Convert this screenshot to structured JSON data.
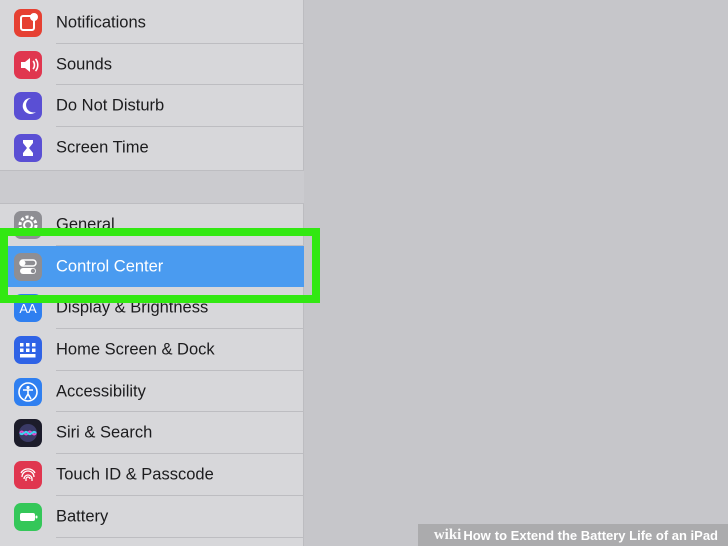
{
  "settings_group_top": [
    {
      "name": "notifications",
      "label": "Notifications",
      "icon": "notifications-icon",
      "color": "#e64032"
    },
    {
      "name": "sounds",
      "label": "Sounds",
      "icon": "speaker-icon",
      "color": "#e0364f"
    },
    {
      "name": "do-not-disturb",
      "label": "Do Not Disturb",
      "icon": "moon-icon",
      "color": "#5a4fd4"
    },
    {
      "name": "screen-time",
      "label": "Screen Time",
      "icon": "hourglass-icon",
      "color": "#5a4fd4"
    }
  ],
  "settings_group_main": [
    {
      "name": "general",
      "label": "General",
      "icon": "gear-icon",
      "color": "#8e8e93"
    },
    {
      "name": "control-center",
      "label": "Control Center",
      "icon": "toggles-icon",
      "color": "#8e8e93",
      "selected": true
    },
    {
      "name": "display-brightness",
      "label": "Display & Brightness",
      "icon": "aa-icon",
      "color": "#2f7ff0"
    },
    {
      "name": "home-screen-dock",
      "label": "Home Screen & Dock",
      "icon": "grid-icon",
      "color": "#2f63e6"
    },
    {
      "name": "accessibility",
      "label": "Accessibility",
      "icon": "accessibility-icon",
      "color": "#2f7ff0"
    },
    {
      "name": "siri-search",
      "label": "Siri & Search",
      "icon": "siri-icon",
      "color": "#1c1c2a"
    },
    {
      "name": "touch-id-passcode",
      "label": "Touch ID & Passcode",
      "icon": "fingerprint-icon",
      "color": "#e0364f"
    },
    {
      "name": "battery",
      "label": "Battery",
      "icon": "battery-icon",
      "color": "#34c759"
    }
  ],
  "watermark": {
    "wiki": "wiki",
    "how": "How",
    "rest": "to Extend the Battery Life of an iPad"
  },
  "highlight_color": "#32e812",
  "selected_row_color": "#4a9bf0"
}
